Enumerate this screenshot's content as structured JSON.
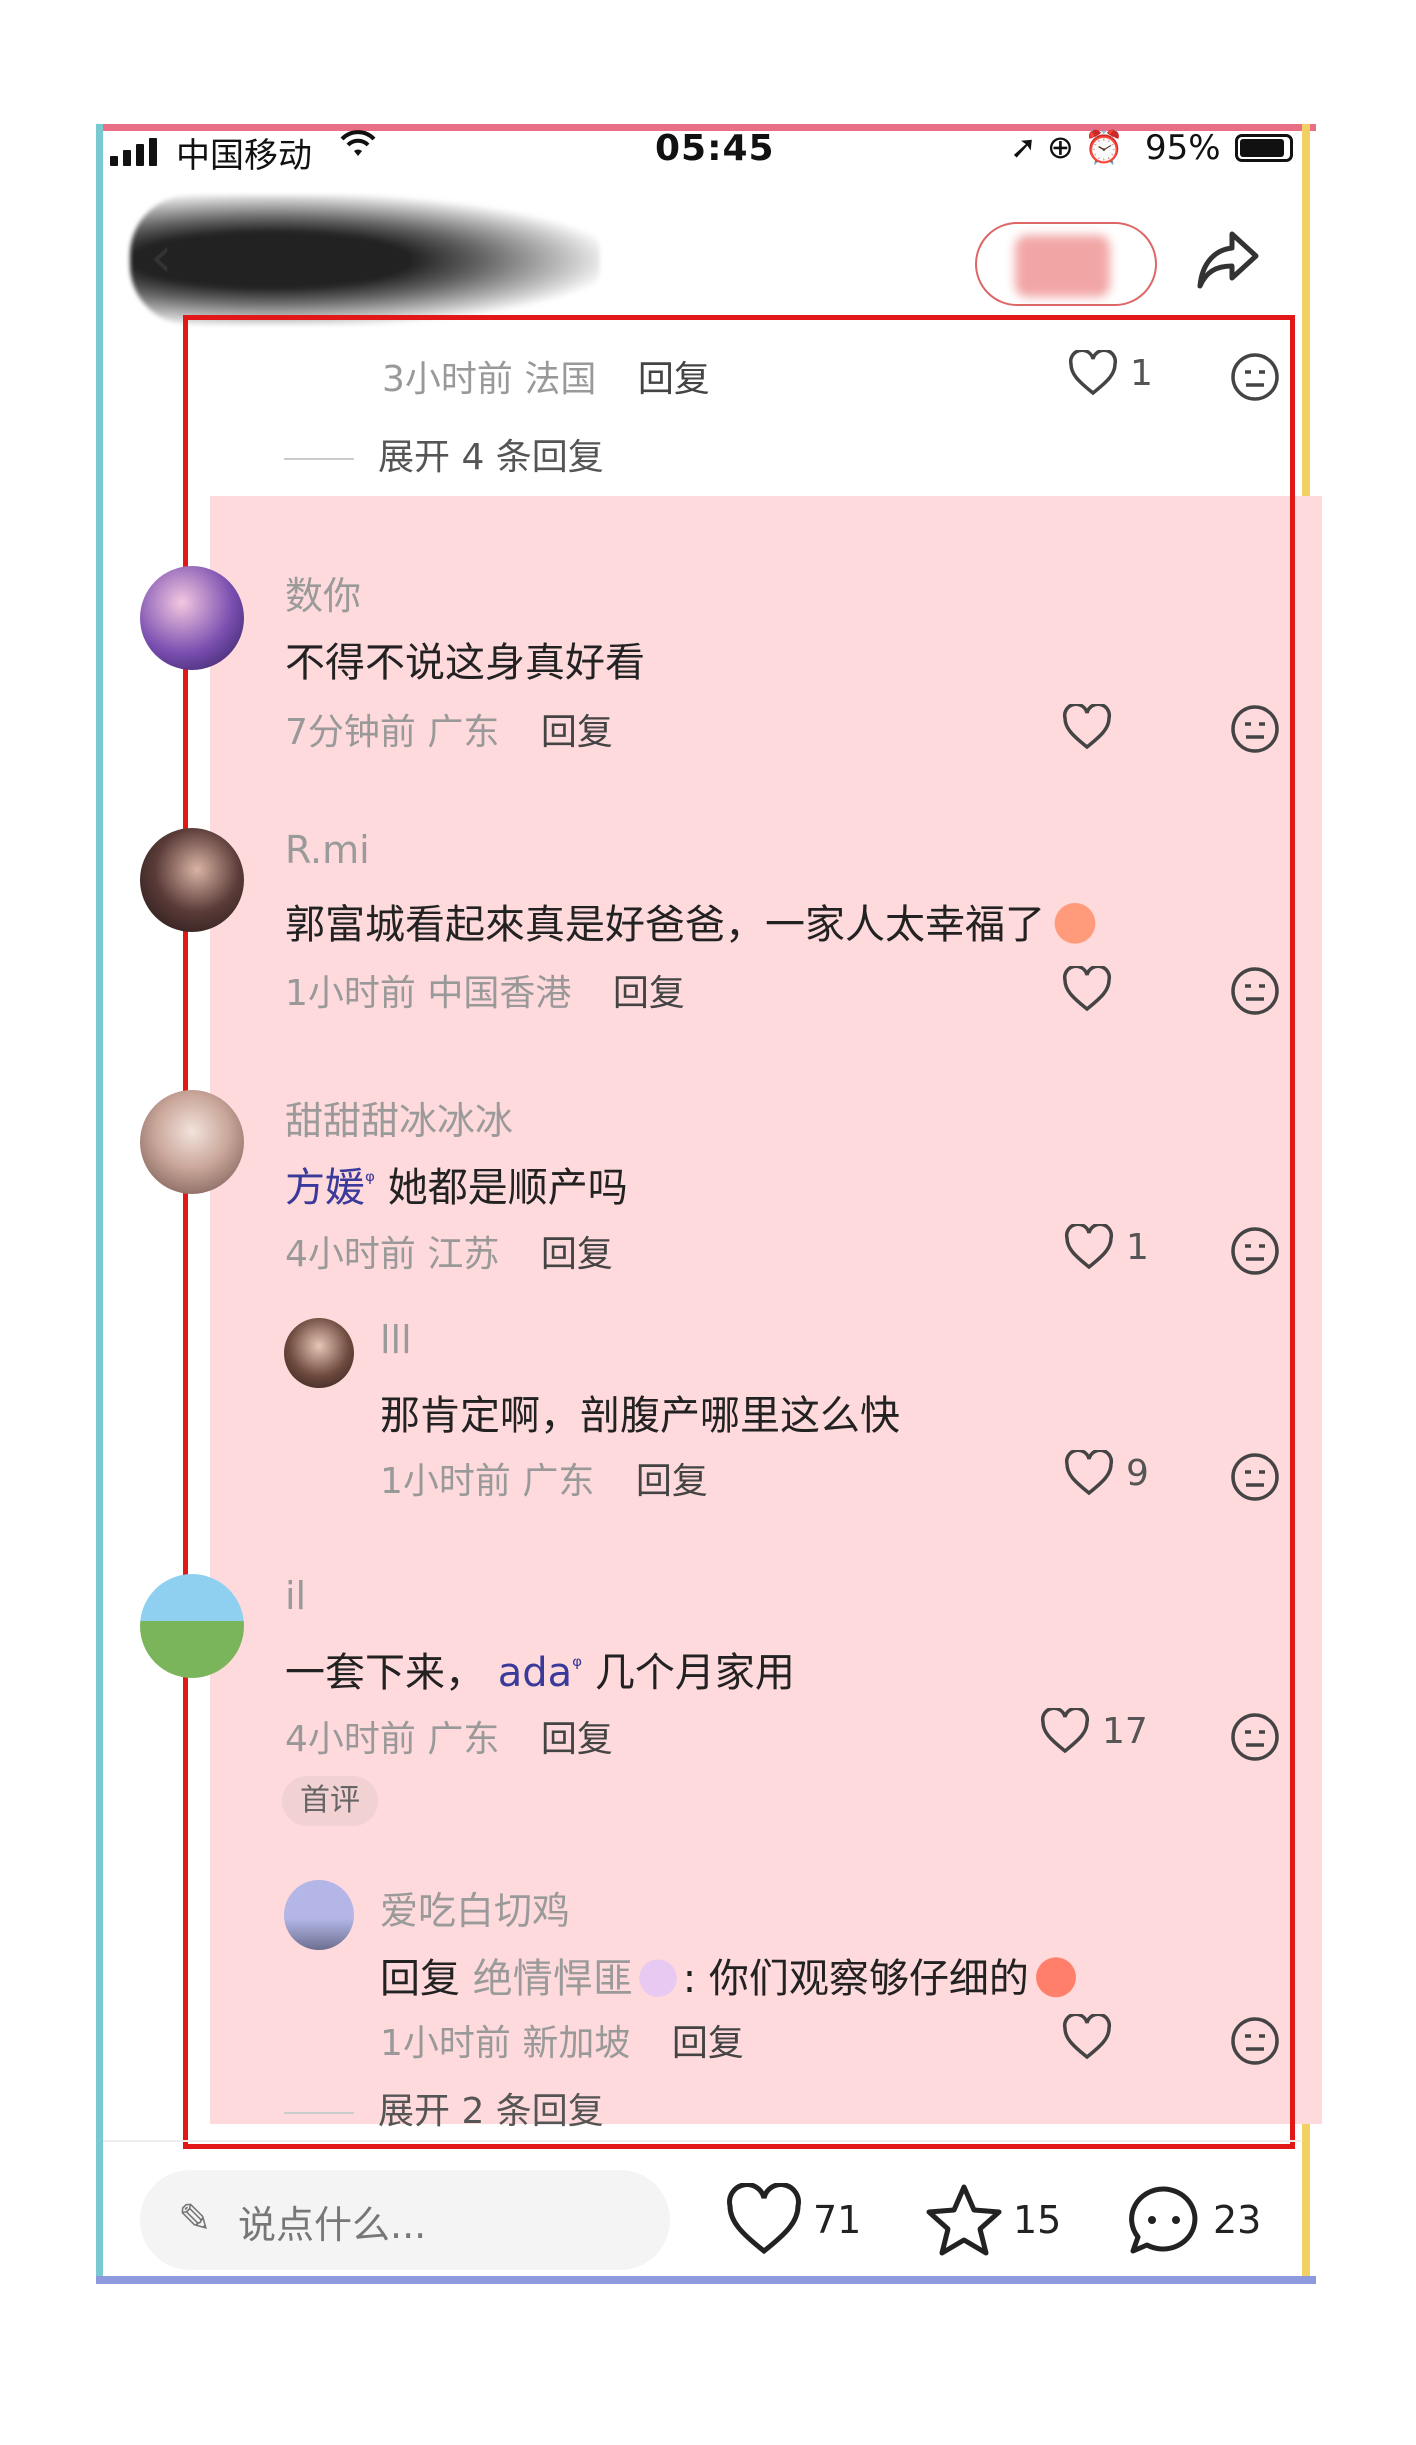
{
  "status_bar": {
    "carrier": "中国移动",
    "time": "05:45",
    "battery": "95%"
  },
  "comments": [
    {
      "time": "3小时前",
      "location": "法国",
      "reply_label": "回复",
      "likes": "1",
      "expand": "展开 4 条回复"
    },
    {
      "user": "数你",
      "text": "不得不说这身真好看",
      "time": "7分钟前",
      "location": "广东",
      "reply_label": "回复"
    },
    {
      "user": "R.mi",
      "text": "郭富城看起來真是好爸爸，一家人太幸福了",
      "time": "1小时前",
      "location": "中国香港",
      "reply_label": "回复"
    },
    {
      "user": "甜甜甜冰冰冰",
      "mention": "方媛",
      "text": "她都是顺产吗",
      "time": "4小时前",
      "location": "江苏",
      "reply_label": "回复",
      "likes": "1",
      "sub_reply": {
        "user": "lll",
        "text": "那肯定啊，剖腹产哪里这么快",
        "time": "1小时前",
        "location": "广东",
        "reply_label": "回复",
        "likes": "9"
      }
    },
    {
      "user": "il",
      "text_before": "一套下来，",
      "mention": "ada",
      "text_after": "几个月家用",
      "time": "4小时前",
      "location": "广东",
      "reply_label": "回复",
      "likes": "17",
      "tag": "首评",
      "sub_reply": {
        "user": "爱吃白切鸡",
        "reply_prefix": "回复",
        "reply_to": "绝情悍匪",
        "text": ": 你们观察够仔细的",
        "time": "1小时前",
        "location": "新加坡",
        "reply_label": "回复",
        "expand": "展开 2 条回复"
      }
    }
  ],
  "bottom_bar": {
    "input_placeholder": "说点什么...",
    "likes": "71",
    "favorites": "15",
    "comments": "23"
  },
  "colors": {
    "frame_top": "#e86f86",
    "frame_left": "#79c9d0",
    "frame_right": "#f1d163",
    "frame_bottom": "#8e9ae0",
    "annotation_box": "#e01818",
    "highlight": "#ffdadc"
  },
  "icons": [
    "signal-icon",
    "wifi-icon",
    "location-icon",
    "lock-rotation-icon",
    "alarm-icon",
    "battery-icon",
    "back-icon",
    "share-icon",
    "heart-icon",
    "emoji-icon",
    "pencil-icon",
    "star-icon",
    "comment-icon"
  ]
}
